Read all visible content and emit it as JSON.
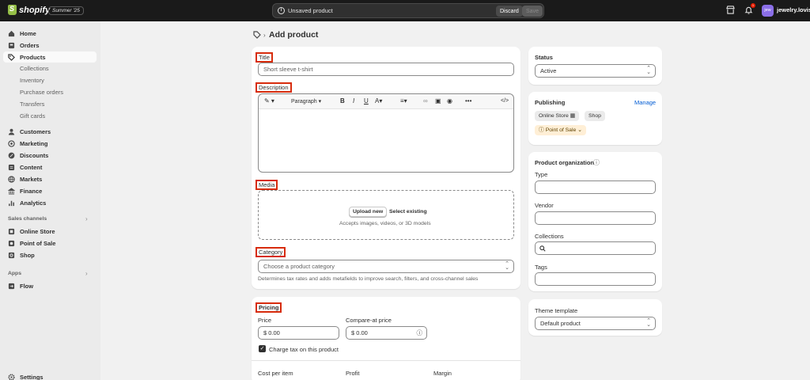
{
  "topbar": {
    "brand": "shopify",
    "edition": "Summer '25",
    "save_message": "Unsaved product",
    "discard_label": "Discard",
    "save_label": "Save",
    "notification_count": "1",
    "avatar_initials": "jew",
    "store_name": "jewelry.lovisa"
  },
  "sidebar": {
    "main": [
      {
        "label": "Home",
        "icon": "home-icon"
      },
      {
        "label": "Orders",
        "icon": "inbox-icon"
      },
      {
        "label": "Products",
        "icon": "tag-icon"
      }
    ],
    "products_sub": [
      "Collections",
      "Inventory",
      "Purchase orders",
      "Transfers",
      "Gift cards"
    ],
    "more": [
      {
        "label": "Customers",
        "icon": "person-icon"
      },
      {
        "label": "Marketing",
        "icon": "target-icon"
      },
      {
        "label": "Discounts",
        "icon": "discount-icon"
      },
      {
        "label": "Content",
        "icon": "content-icon"
      },
      {
        "label": "Markets",
        "icon": "globe-icon"
      },
      {
        "label": "Finance",
        "icon": "bank-icon"
      },
      {
        "label": "Analytics",
        "icon": "chart-icon"
      }
    ],
    "sales_channels_label": "Sales channels",
    "sales_channels": [
      {
        "label": "Online Store",
        "icon": "store-icon"
      },
      {
        "label": "Point of Sale",
        "icon": "pos-icon"
      },
      {
        "label": "Shop",
        "icon": "shop-icon"
      }
    ],
    "apps_label": "Apps",
    "apps": [
      {
        "label": "Flow",
        "icon": "flow-icon"
      }
    ],
    "settings_label": "Settings"
  },
  "page": {
    "title": "Add product",
    "separator": "›"
  },
  "main": {
    "title_label": "Title",
    "title_placeholder": "Short sleeve t-shirt",
    "description_label": "Description",
    "paragraph_label": "Paragraph",
    "media_label": "Media",
    "upload_label": "Upload new",
    "select_existing_label": "Select existing",
    "media_help": "Accepts images, videos, or 3D models",
    "category_label": "Category",
    "category_placeholder": "Choose a product category",
    "category_help": "Determines tax rates and adds metafields to improve search, filters, and cross-channel sales"
  },
  "pricing": {
    "heading": "Pricing",
    "price_label": "Price",
    "price_value": "$  0.00",
    "compare_label": "Compare-at price",
    "compare_value": "$  0.00",
    "charge_tax_label": "Charge tax on this product",
    "cost_label": "Cost per item",
    "profit_label": "Profit",
    "margin_label": "Margin"
  },
  "status": {
    "heading": "Status",
    "value": "Active"
  },
  "publishing": {
    "heading": "Publishing",
    "manage_label": "Manage",
    "channels": [
      "Online Store",
      "Shop"
    ],
    "pos_label": "Point of Sale"
  },
  "organization": {
    "heading": "Product organization",
    "type_label": "Type",
    "vendor_label": "Vendor",
    "collections_label": "Collections",
    "tags_label": "Tags"
  },
  "theme": {
    "heading": "Theme template",
    "value": "Default product"
  },
  "colors": {
    "accent": "#005bd3",
    "highlight": "#d72c0d",
    "topbar": "#1a1a1a"
  }
}
